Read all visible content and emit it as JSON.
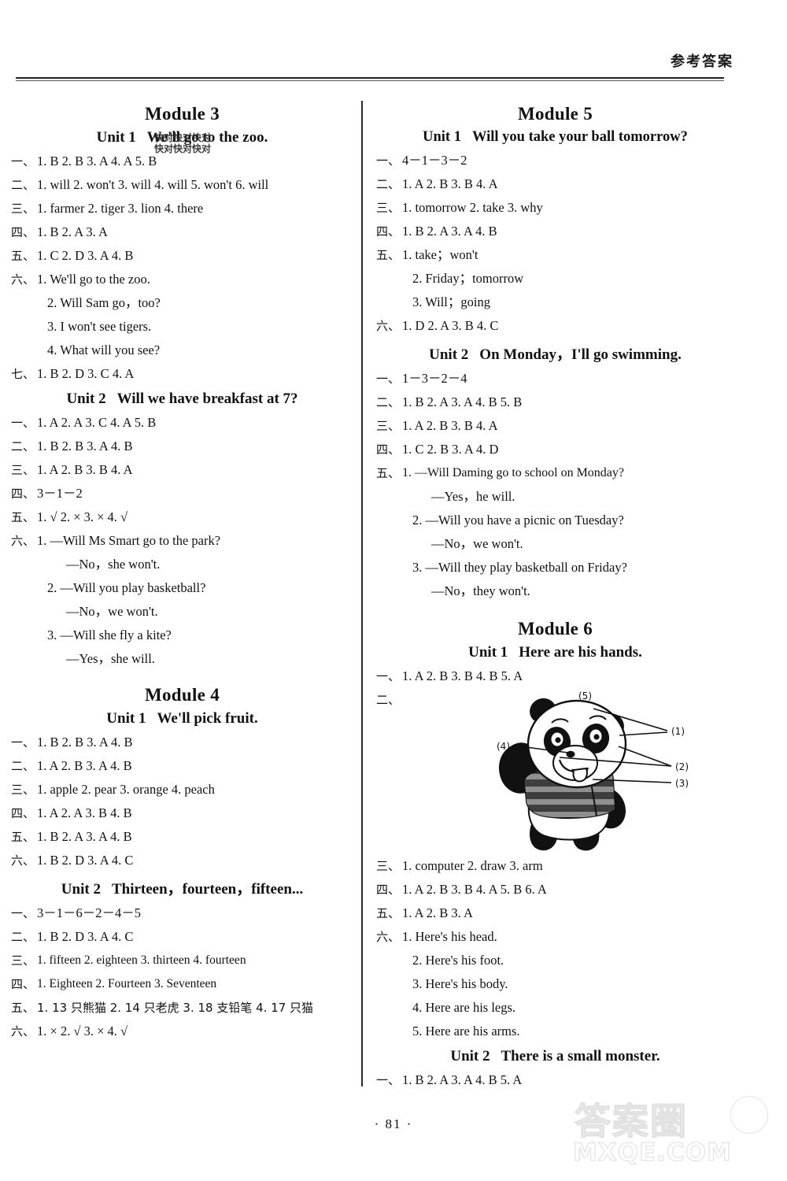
{
  "header": {
    "title": "参考答案"
  },
  "footer": {
    "page_number": "· 81 ·"
  },
  "watermarks": {
    "top_overlay": "快对快对快对",
    "brand_cn": "答案圈",
    "brand_en": "MXQE.COM"
  },
  "left_column": {
    "module3": {
      "title": "Module 3",
      "unit1": {
        "label": "Unit 1",
        "name": "We'll go to the zoo.",
        "answers": [
          {
            "marker": "一、",
            "text": "1. B  2. B  3. A  4. A  5. B"
          },
          {
            "marker": "二、",
            "text": "1. will  2. won't  3. will  4. will  5. won't  6. will"
          },
          {
            "marker": "三、",
            "text": "1. farmer  2. tiger  3. lion  4. there"
          },
          {
            "marker": "四、",
            "text": "1. B  2. A  3. A"
          },
          {
            "marker": "五、",
            "text": "1. C  2. D  3. A  4. B"
          },
          {
            "marker": "六、",
            "text": "1. We'll go to the zoo."
          },
          {
            "marker": "七、",
            "text": "1. B  2. D  3. C  4. A"
          }
        ],
        "six_sublines": [
          "2. Will Sam go，too?",
          "3. I won't see tigers.",
          "4. What will you see?"
        ]
      },
      "unit2": {
        "label": "Unit 2",
        "name": "Will we have breakfast at 7?",
        "answers": [
          {
            "marker": "一、",
            "text": "1. A  2. A  3. C  4. A  5. B"
          },
          {
            "marker": "二、",
            "text": "1. B  2. B  3. A  4. B"
          },
          {
            "marker": "三、",
            "text": "1. A  2. B  3. B  4. A"
          },
          {
            "marker": "四、",
            "text": "3－1－2"
          },
          {
            "marker": "五、",
            "text": "1. √  2. ×  3. ×  4. √"
          },
          {
            "marker": "六、",
            "text": "1. —Will Ms Smart go to the park?"
          }
        ],
        "six_sublines": [
          "—No，she won't.",
          "2. —Will you play basketball?",
          "—No，we won't.",
          "3. —Will she fly a kite?",
          "—Yes，she will."
        ]
      }
    },
    "module4": {
      "title": "Module 4",
      "unit1": {
        "label": "Unit 1",
        "name": "We'll pick fruit.",
        "answers": [
          {
            "marker": "一、",
            "text": "1. B  2. B  3. A  4. B"
          },
          {
            "marker": "二、",
            "text": "1. A  2. B  3. A  4. B"
          },
          {
            "marker": "三、",
            "text": "1. apple  2. pear  3. orange  4. peach"
          },
          {
            "marker": "四、",
            "text": "1. A  2. A  3. B  4. B"
          },
          {
            "marker": "五、",
            "text": "1. B  2. A  3. A  4. B"
          },
          {
            "marker": "六、",
            "text": "1. B  2. D  3. A  4. C"
          }
        ]
      },
      "unit2": {
        "label": "Unit 2",
        "name": "Thirteen，fourteen，fifteen...",
        "answers": [
          {
            "marker": "一、",
            "text": "3－1－6－2－4－5"
          },
          {
            "marker": "二、",
            "text": "1. B  2. D  3. A  4. C"
          },
          {
            "marker": "三、",
            "text": "1. fifteen  2. eighteen  3. thirteen  4. fourteen"
          },
          {
            "marker": "四、",
            "text": "1. Eighteen  2. Fourteen  3. Seventeen"
          },
          {
            "marker": "五、",
            "text": "1. 13 只熊猫  2. 14 只老虎  3. 18 支铅笔  4. 17 只猫"
          },
          {
            "marker": "六、",
            "text": "1. ×  2. √  3. ×  4. √"
          }
        ]
      }
    }
  },
  "right_column": {
    "module5": {
      "title": "Module 5",
      "unit1": {
        "label": "Unit 1",
        "name": "Will you take your ball tomorrow?",
        "answers": [
          {
            "marker": "一、",
            "text": "4－1－3－2"
          },
          {
            "marker": "二、",
            "text": "1. A  2. B  3. B  4. A"
          },
          {
            "marker": "三、",
            "text": "1. tomorrow  2. take  3. why"
          },
          {
            "marker": "四、",
            "text": "1. B  2. A  3. A  4. B"
          },
          {
            "marker": "五、",
            "text": "1. take；won't"
          },
          {
            "marker": "六、",
            "text": "1. D  2. A  3. B  4. C"
          }
        ],
        "five_sublines": [
          "2. Friday；tomorrow",
          "3. Will；going"
        ]
      },
      "unit2": {
        "label": "Unit 2",
        "name": "On Monday，I'll go swimming.",
        "answers": [
          {
            "marker": "一、",
            "text": "1－3－2－4"
          },
          {
            "marker": "二、",
            "text": "1. B  2. A  3. A  4. B  5. B"
          },
          {
            "marker": "三、",
            "text": "1. A  2. B  3. B  4. A"
          },
          {
            "marker": "四、",
            "text": "1. C  2. B  3. A  4. D"
          },
          {
            "marker": "五、",
            "text": "1. —Will Daming go to school on Monday?"
          }
        ],
        "five_sublines": [
          "—Yes，he will.",
          "2. —Will you have a picnic on Tuesday?",
          "—No，we won't.",
          "3. —Will they play basketball on Friday?",
          "—No，they won't."
        ]
      }
    },
    "module6": {
      "title": "Module 6",
      "unit1": {
        "label": "Unit 1",
        "name": "Here are his hands.",
        "answers_before_figure": [
          {
            "marker": "一、",
            "text": "1. A  2. B  3. B  4. B  5. A"
          }
        ],
        "figure_marker": "二、",
        "figure": {
          "name": "panda-labelled-diagram",
          "labels": [
            "(1)",
            "(2)",
            "(3)",
            "(4)",
            "(5)"
          ]
        },
        "answers_after_figure": [
          {
            "marker": "三、",
            "text": "1. computer  2. draw  3. arm"
          },
          {
            "marker": "四、",
            "text": "1. A  2. B  3. B  4. A  5. B  6. A"
          },
          {
            "marker": "五、",
            "text": "1. A  2. B  3. A"
          },
          {
            "marker": "六、",
            "text": "1. Here's his head."
          }
        ],
        "six_sublines": [
          "2. Here's his foot.",
          "3. Here's his body.",
          "4. Here are his legs.",
          "5. Here are his arms."
        ]
      },
      "unit2": {
        "label": "Unit 2",
        "name": "There is a small monster.",
        "answers": [
          {
            "marker": "一、",
            "text": "1. B  2. A  3. A  4. B  5. A"
          }
        ]
      }
    }
  }
}
